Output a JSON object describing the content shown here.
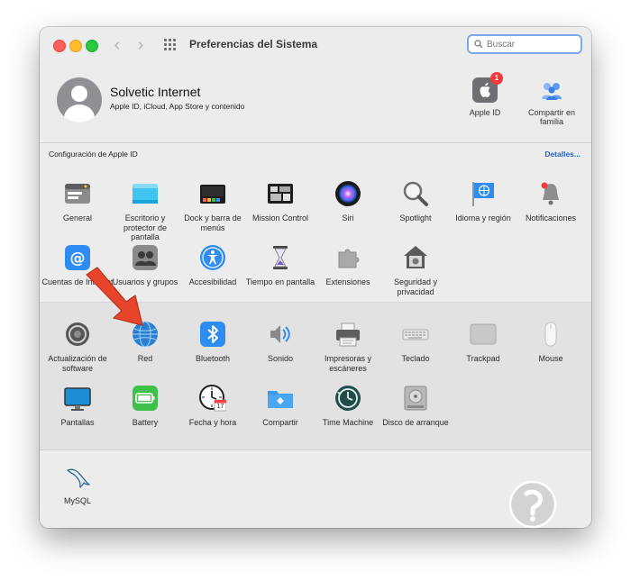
{
  "window": {
    "title": "Preferencias del Sistema",
    "search_placeholder": "Buscar"
  },
  "account": {
    "name": "Solvetic Internet",
    "subtitle": "Apple ID, iCloud, App Store y contenido",
    "items": [
      {
        "label": "Apple ID",
        "icon": "apple-id-icon",
        "badge": "1"
      },
      {
        "label": "Compartir en familia",
        "icon": "family-sharing-icon"
      }
    ]
  },
  "apple_id_bar": {
    "label": "Configuración de Apple ID",
    "details_link": "Detalles..."
  },
  "panes_row1": [
    {
      "label": "General",
      "icon": "general-icon"
    },
    {
      "label": "Escritorio y protector de pantalla",
      "icon": "desktop-icon"
    },
    {
      "label": "Dock y barra de menús",
      "icon": "dock-icon"
    },
    {
      "label": "Mission Control",
      "icon": "mission-control-icon"
    },
    {
      "label": "Siri",
      "icon": "siri-icon"
    },
    {
      "label": "Spotlight",
      "icon": "spotlight-icon"
    },
    {
      "label": "Idioma y región",
      "icon": "language-region-icon"
    },
    {
      "label": "Notificaciones",
      "icon": "notifications-icon"
    }
  ],
  "panes_row2": [
    {
      "label": "Cuentas de Internet",
      "icon": "internet-accounts-icon"
    },
    {
      "label": "Usuarios y grupos",
      "icon": "users-groups-icon"
    },
    {
      "label": "Accesibilidad",
      "icon": "accessibility-icon"
    },
    {
      "label": "Tiempo en pantalla",
      "icon": "screen-time-icon"
    },
    {
      "label": "Extensiones",
      "icon": "extensions-icon"
    },
    {
      "label": "Seguridad y privacidad",
      "icon": "security-privacy-icon"
    }
  ],
  "panes_row3": [
    {
      "label": "Actualización de software",
      "icon": "software-update-icon"
    },
    {
      "label": "Red",
      "icon": "network-icon"
    },
    {
      "label": "Bluetooth",
      "icon": "bluetooth-icon"
    },
    {
      "label": "Sonido",
      "icon": "sound-icon"
    },
    {
      "label": "Impresoras y escáneres",
      "icon": "printers-icon"
    },
    {
      "label": "Teclado",
      "icon": "keyboard-icon"
    },
    {
      "label": "Trackpad",
      "icon": "trackpad-icon"
    },
    {
      "label": "Mouse",
      "icon": "mouse-icon"
    }
  ],
  "panes_row4": [
    {
      "label": "Pantallas",
      "icon": "displays-icon"
    },
    {
      "label": "Battery",
      "icon": "battery-icon"
    },
    {
      "label": "Fecha y hora",
      "icon": "date-time-icon",
      "calendar_day": "17"
    },
    {
      "label": "Compartir",
      "icon": "sharing-icon"
    },
    {
      "label": "Time Machine",
      "icon": "time-machine-icon"
    },
    {
      "label": "Disco de arranque",
      "icon": "startup-disk-icon"
    }
  ],
  "third_party": [
    {
      "label": "MySQL",
      "icon": "mysql-icon"
    }
  ],
  "colors": {
    "accent": "#2463c7",
    "badge": "#f23b3b",
    "annotation_arrow": "#e8452c"
  }
}
